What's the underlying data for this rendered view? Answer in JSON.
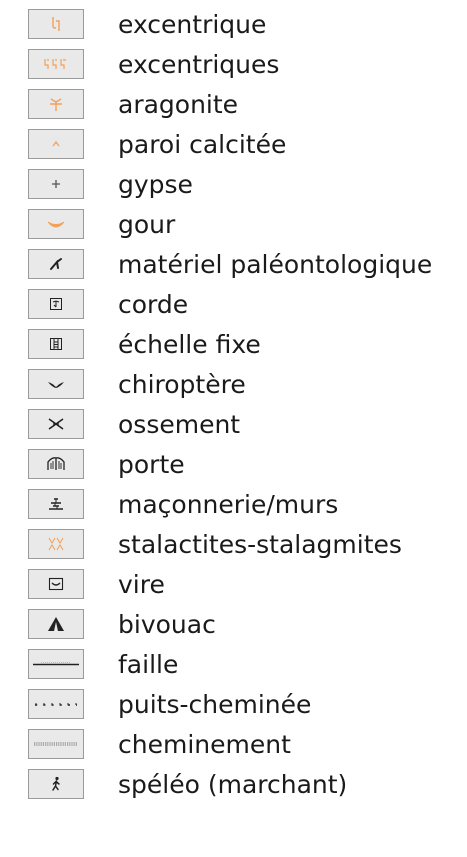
{
  "colors": {
    "orange_symbol": "#f2a05a",
    "dark_symbol": "#222222",
    "gray_symbol": "#555555",
    "box_fill": "#e9e9e9",
    "box_border": "#9a9a9a"
  },
  "legend": {
    "items": [
      {
        "label": "excentrique",
        "icon": "excentrique-icon"
      },
      {
        "label": "excentriques",
        "icon": "excentriques-icon"
      },
      {
        "label": "aragonite",
        "icon": "aragonite-icon"
      },
      {
        "label": "paroi calcitée",
        "icon": "paroi-calcitee-icon"
      },
      {
        "label": "gypse",
        "icon": "gypse-icon"
      },
      {
        "label": "gour",
        "icon": "gour-icon"
      },
      {
        "label": "matériel paléontologique",
        "icon": "materiel-paleontologique-icon"
      },
      {
        "label": "corde",
        "icon": "corde-icon"
      },
      {
        "label": "échelle fixe",
        "icon": "echelle-fixe-icon"
      },
      {
        "label": "chiroptère",
        "icon": "chiroptere-icon"
      },
      {
        "label": "ossement",
        "icon": "ossement-icon"
      },
      {
        "label": "porte",
        "icon": "porte-icon"
      },
      {
        "label": "maçonnerie/murs",
        "icon": "maconnerie-murs-icon"
      },
      {
        "label": "stalactites-stalagmites",
        "icon": "stalactites-stalagmites-icon"
      },
      {
        "label": "vire",
        "icon": "vire-icon"
      },
      {
        "label": "bivouac",
        "icon": "bivouac-icon"
      },
      {
        "label": "faille",
        "icon": "faille-icon"
      },
      {
        "label": "puits-cheminée",
        "icon": "puits-cheminee-icon"
      },
      {
        "label": "cheminement",
        "icon": "cheminement-icon"
      },
      {
        "label": "spéléo (marchant)",
        "icon": "speleo-marchant-icon"
      }
    ]
  }
}
